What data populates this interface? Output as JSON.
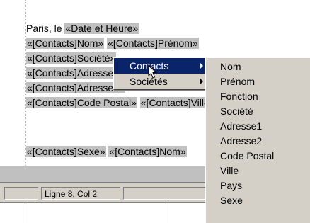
{
  "document": {
    "lines": [
      [
        {
          "text": "Paris, le ",
          "field": false
        },
        {
          "text": "«Date et Heure»",
          "field": true
        }
      ],
      [
        {
          "text": "«[Contacts]Nom»",
          "field": true
        },
        {
          "text": " ",
          "field": false
        },
        {
          "text": "«[Contacts]Prénom»",
          "field": true
        }
      ],
      [
        {
          "text": "«[Contacts]Société»",
          "field": true
        }
      ],
      [
        {
          "text": "«[Contacts]Adresse1»",
          "field": true
        }
      ],
      [
        {
          "text": "«[Contacts]Adresse2»",
          "field": true
        }
      ],
      [
        {
          "text": "«[Contacts]Code Postal»",
          "field": true
        },
        {
          "text": " ",
          "field": false
        },
        {
          "text": "«[Contacts]Ville»",
          "field": true
        }
      ],
      [],
      [],
      [
        {
          "text": "«[Contacts]Sexe»",
          "field": true
        },
        {
          "text": " ",
          "field": false
        },
        {
          "text": "«[Contacts]Nom»",
          "field": true
        }
      ]
    ]
  },
  "status": {
    "position": "Ligne 8, Col 2"
  },
  "context_menu": {
    "items": [
      {
        "label": "Contacts",
        "active": true
      },
      {
        "label": "Sociétés",
        "active": false
      }
    ]
  },
  "submenu": {
    "items": [
      "Nom",
      "Prénom",
      "Fonction",
      "Société",
      "Adresse1",
      "Adresse2",
      "Code Postal",
      "Ville",
      "Pays",
      "Sexe"
    ]
  },
  "colors": {
    "field_bg": "#c0c0c0",
    "menu_bg": "#d4d0c8",
    "highlight": "#0a246a"
  }
}
